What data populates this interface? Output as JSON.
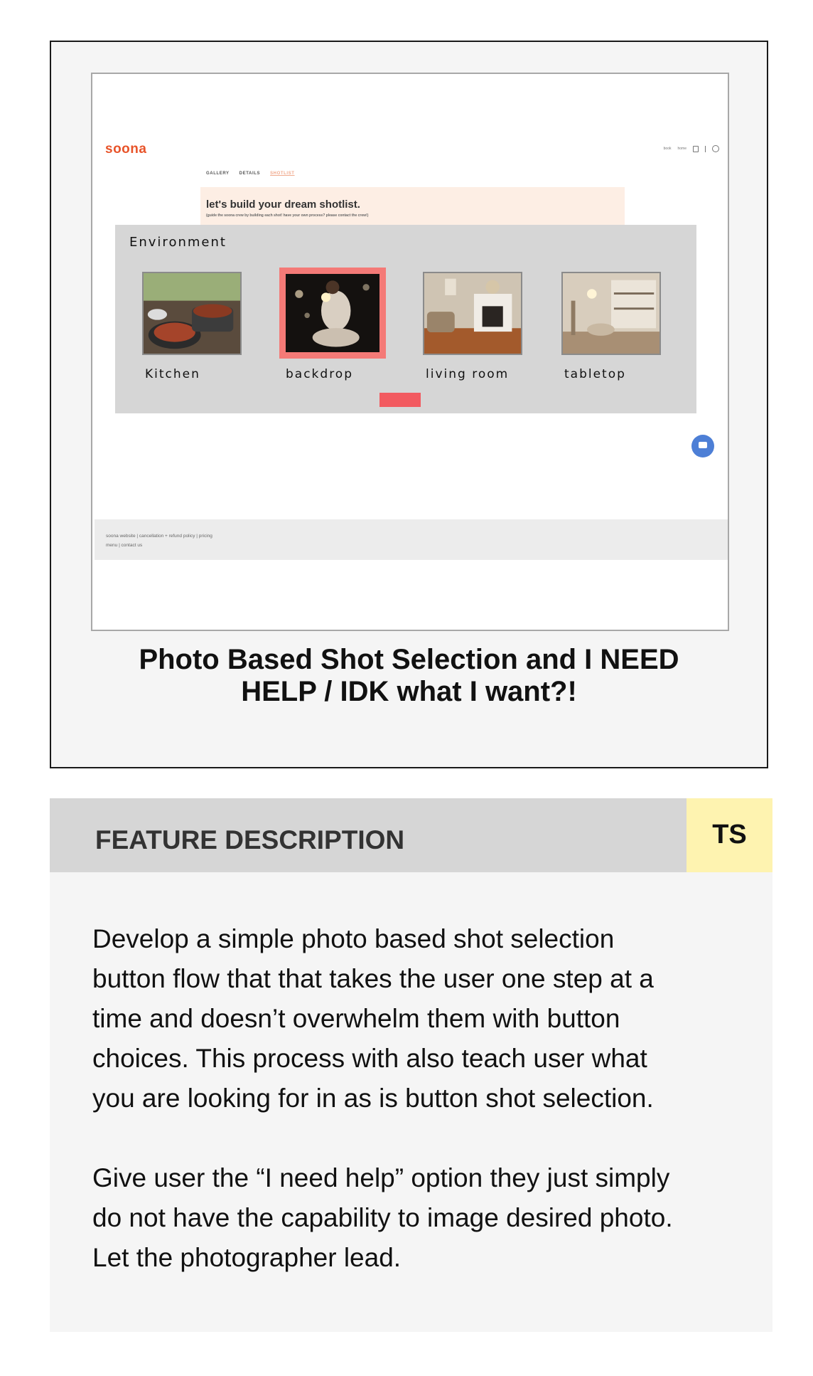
{
  "screenshot": {
    "logo": "soona",
    "top_nav": [
      "book",
      "home"
    ],
    "sub_nav": [
      "GALLERY",
      "DETAILS",
      "SHOTLIST"
    ],
    "banner": {
      "title": "let's build your dream shotlist.",
      "subtitle": "(guide the soona crew by building each shot! have your own process? please contact the crew!)"
    },
    "modal": {
      "label": "Environment",
      "options": [
        "Kitchen",
        "backdrop",
        "living room",
        "tabletop"
      ],
      "selected": "backdrop"
    },
    "footer": {
      "line1": "soona website | cancellation + refund policy | pricing",
      "line2": "menu | contact us"
    },
    "colors": {
      "accent": "#f47a77",
      "button": "#f25a60",
      "brand": "#e8542a",
      "chat": "#4d7fd6"
    }
  },
  "caption": {
    "line1": "Photo Based Shot Selection and I NEED",
    "line2": "HELP / IDK what I want?!"
  },
  "feature": {
    "title": "FEATURE DESCRIPTION",
    "tag": "TS",
    "tag_color": "#fef3b0",
    "paragraph1": [
      "Develop a simple photo based shot selection",
      "button flow that that takes the user one step at a",
      "time and doesn’t overwhelm them with button",
      "choices. This process with also teach user what",
      "you are looking for in as is button shot selection."
    ],
    "paragraph2": [
      "Give user the “I need help” option they just simply",
      "do not have the capability to image desired photo.",
      "Let the photographer lead."
    ]
  }
}
